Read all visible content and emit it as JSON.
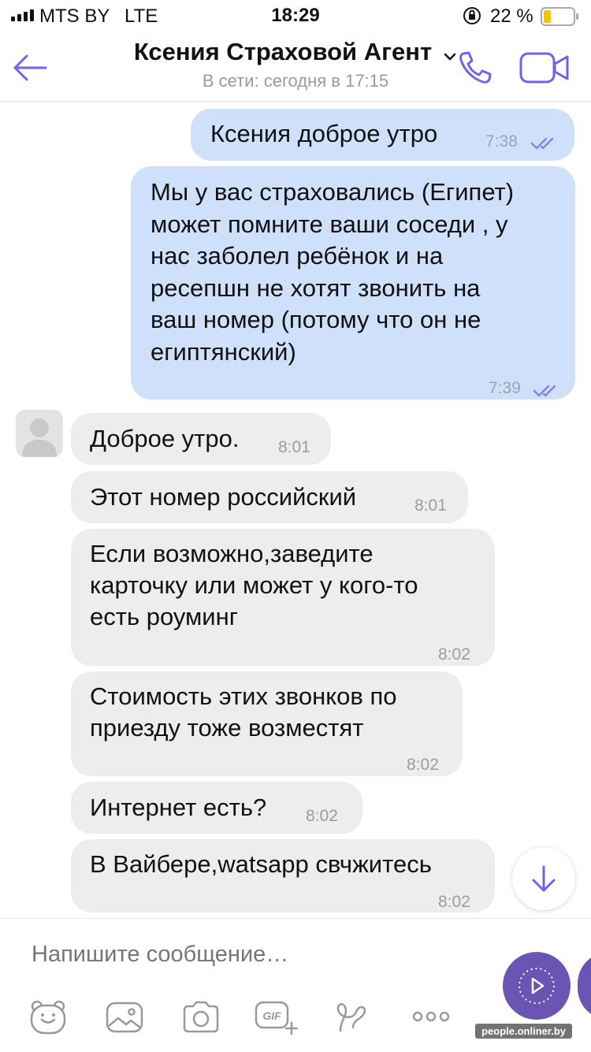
{
  "status_bar": {
    "carrier": "MTS BY",
    "network": "LTE",
    "time": "18:29",
    "battery_percent": "22 %"
  },
  "header": {
    "contact_name": "Ксения Страховой Агент",
    "presence": "В сети: сегодня в 17:15"
  },
  "messages": [
    {
      "direction": "out",
      "text": "Ксения доброе утро",
      "time": "7:38"
    },
    {
      "direction": "out",
      "text": "Мы у вас страховались (Египет)\nможет помните ваши соседи , у\nнас заболел ребёнок и на\nресепшн не хотят звонить на\nваш номер (потому что он не\nегиптянский)",
      "time": "7:39"
    },
    {
      "direction": "in",
      "text": "Доброе утро.",
      "time": "8:01"
    },
    {
      "direction": "in",
      "text": "Этот номер российский",
      "time": "8:01"
    },
    {
      "direction": "in",
      "text": "Если возможно,заведите\nкарточку или может у кого-то\nесть роуминг",
      "time": "8:02"
    },
    {
      "direction": "in",
      "text": "Стоимость этих звонков по\nприезду тоже возместят",
      "time": "8:02"
    },
    {
      "direction": "in",
      "text": "Интернет есть?",
      "time": "8:02"
    },
    {
      "direction": "in",
      "text": "В Вайбере,watsapp свчжитесь",
      "time": "8:02"
    }
  ],
  "composer": {
    "placeholder": "Напишите сообщение…",
    "toolbar_icons": [
      "sticker-icon",
      "gallery-icon",
      "camera-icon",
      "gif-icon",
      "doodle-icon",
      "more-icon"
    ],
    "gif_label": "GIF"
  },
  "watermark": "people.onliner.by",
  "colors": {
    "accent": "#7360f2",
    "outgoing_bubble": "#cfe1fa",
    "incoming_bubble": "#ededed",
    "send_button": "#6a55b4"
  }
}
